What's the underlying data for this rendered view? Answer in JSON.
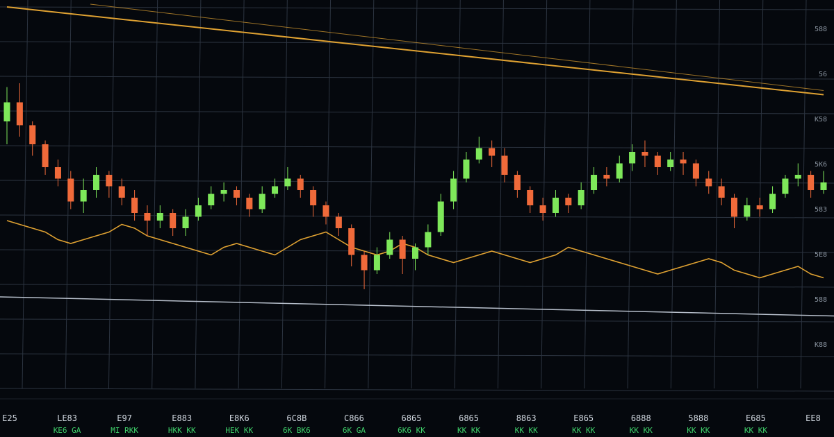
{
  "colors": {
    "background": "#05080d",
    "grid": "#2c3440",
    "up": "#7ee85a",
    "down": "#f06a3a",
    "signal": "#e0a232",
    "trend_line": "#e0a232",
    "baseline": "#b8c0cc"
  },
  "chart_data": {
    "type": "candlestick",
    "title": "",
    "xlabel": "",
    "ylabel": "",
    "ylim": [
      0,
      100
    ],
    "grid": true,
    "x_tick_labels": [
      "E25",
      "LE83",
      "E97",
      "E883",
      "E8K6",
      "6C8B",
      "C866",
      "6865",
      "6865",
      "8863",
      "E865",
      "6888",
      "5888",
      "E685",
      "EE8"
    ],
    "x_tick_sublabels": [
      "",
      "KE6 GA",
      "MI RKK",
      "HKK KK",
      "HEK KK",
      "6K BK6",
      "6K GA",
      "6K6 KK",
      "KK KK",
      "KK KK",
      "KK KK",
      "KK KK",
      "KK KK",
      "KK KK",
      ""
    ],
    "y_tick_labels_right": [
      "588",
      "56",
      "K58",
      "5K6",
      "583",
      "5E8",
      "588",
      "K88"
    ],
    "candles": [
      [
        70,
        75,
        79,
        64
      ],
      [
        75,
        69,
        80,
        66
      ],
      [
        69,
        64,
        70,
        61
      ],
      [
        64,
        58,
        65,
        56
      ],
      [
        58,
        55,
        60,
        53
      ],
      [
        55,
        49,
        57,
        47
      ],
      [
        49,
        52,
        55,
        46
      ],
      [
        52,
        56,
        58,
        50
      ],
      [
        56,
        53,
        57,
        50
      ],
      [
        53,
        50,
        55,
        48
      ],
      [
        50,
        46,
        52,
        44
      ],
      [
        46,
        44,
        48,
        40
      ],
      [
        44,
        46,
        48,
        42
      ],
      [
        46,
        42,
        47,
        40
      ],
      [
        42,
        45,
        47,
        40
      ],
      [
        45,
        48,
        50,
        44
      ],
      [
        48,
        51,
        53,
        47
      ],
      [
        51,
        52,
        54,
        49
      ],
      [
        52,
        50,
        53,
        48
      ],
      [
        50,
        47,
        51,
        45
      ],
      [
        47,
        51,
        53,
        46
      ],
      [
        51,
        53,
        55,
        50
      ],
      [
        53,
        55,
        58,
        52
      ],
      [
        55,
        52,
        56,
        50
      ],
      [
        52,
        48,
        53,
        45
      ],
      [
        48,
        45,
        49,
        43
      ],
      [
        45,
        42,
        46,
        40
      ],
      [
        42,
        35,
        43,
        32
      ],
      [
        35,
        31,
        36,
        26
      ],
      [
        31,
        35,
        37,
        30
      ],
      [
        35,
        39,
        41,
        34
      ],
      [
        39,
        34,
        40,
        30
      ],
      [
        34,
        37,
        38,
        31
      ],
      [
        37,
        41,
        43,
        35
      ],
      [
        41,
        49,
        51,
        40
      ],
      [
        49,
        55,
        57,
        47
      ],
      [
        55,
        60,
        62,
        54
      ],
      [
        60,
        63,
        66,
        59
      ],
      [
        63,
        61,
        65,
        58
      ],
      [
        61,
        56,
        63,
        54
      ],
      [
        56,
        52,
        57,
        50
      ],
      [
        52,
        48,
        53,
        46
      ],
      [
        48,
        46,
        50,
        44
      ],
      [
        46,
        50,
        52,
        45
      ],
      [
        50,
        48,
        51,
        46
      ],
      [
        48,
        52,
        54,
        47
      ],
      [
        52,
        56,
        58,
        51
      ],
      [
        56,
        55,
        58,
        53
      ],
      [
        55,
        59,
        61,
        54
      ],
      [
        59,
        62,
        64,
        57
      ],
      [
        62,
        61,
        65,
        58
      ],
      [
        61,
        58,
        62,
        56
      ],
      [
        58,
        60,
        62,
        57
      ],
      [
        60,
        59,
        62,
        56
      ],
      [
        59,
        55,
        60,
        53
      ],
      [
        55,
        53,
        57,
        51
      ],
      [
        53,
        50,
        55,
        48
      ],
      [
        50,
        45,
        51,
        42
      ],
      [
        45,
        48,
        50,
        44
      ],
      [
        48,
        47,
        50,
        45
      ],
      [
        47,
        51,
        53,
        46
      ],
      [
        51,
        55,
        56,
        50
      ],
      [
        55,
        56,
        59,
        53
      ],
      [
        56,
        52,
        57,
        50
      ],
      [
        52,
        54,
        57,
        51
      ]
    ],
    "signal_line": [
      44,
      43,
      42,
      41,
      39,
      38,
      39,
      40,
      41,
      43,
      42,
      40,
      39,
      38,
      37,
      36,
      35,
      37,
      38,
      37,
      36,
      35,
      37,
      39,
      40,
      41,
      39,
      37,
      36,
      35,
      36,
      38,
      37,
      35,
      34,
      33,
      34,
      35,
      36,
      35,
      34,
      33,
      34,
      35,
      37,
      36,
      35,
      34,
      33,
      32,
      31,
      30,
      31,
      32,
      33,
      34,
      33,
      31,
      30,
      29,
      30,
      31,
      32,
      30,
      29
    ],
    "trend_line": [
      [
        0,
        100
      ],
      [
        64,
        77
      ]
    ],
    "baseline": [
      [
        0,
        24
      ],
      [
        64,
        19
      ]
    ]
  }
}
